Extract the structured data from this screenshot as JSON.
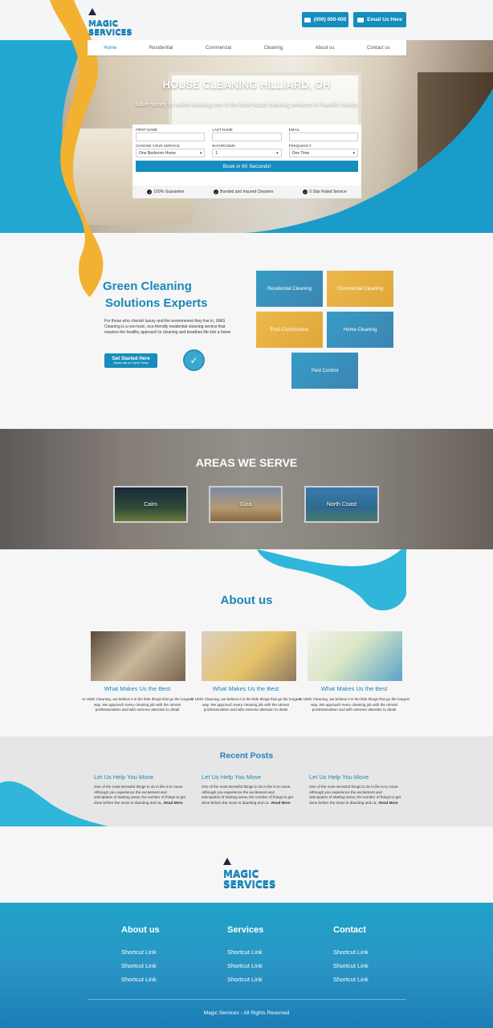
{
  "brand": {
    "line1": "MAGIC",
    "line2": "SERVICES"
  },
  "header": {
    "phone": "(000) 000-000",
    "email_label": "Email Us Here"
  },
  "nav": [
    "Home",
    "Residential",
    "Commercial",
    "Cleaning",
    "About us",
    "Contact us"
  ],
  "hero": {
    "title": "HOUSE CLEANING HILLIARD, OH",
    "subtitle": "Save money by online booking one of the best house cleaning services in Franklin county"
  },
  "form": {
    "first_name_label": "FIRST NAME",
    "last_name_label": "LAST NAME",
    "email_label": "EMAIL",
    "service_label": "CHOOSE YOUR SERVICE",
    "service_value": "One Bedroom Home",
    "bathrooms_label": "BATHROOMS",
    "bathrooms_value": "1",
    "frequency_label": "FREQUENCY",
    "frequency_value": "One Time",
    "book_label": "Book in 60 Seconds!"
  },
  "guarantees": [
    "100% Guarantee",
    "Bonded and Insured Cleaners",
    "5 Star Rated Service"
  ],
  "green": {
    "title_line1": "Green Cleaning",
    "title_line2": "Solutions Experts",
    "text": "For those who cherish luxury and the environment they live in, UMG Cleaning is a non-toxic, eco-friendly residential cleaning service that masters the healthy approach to cleaning and breathes life into a home",
    "cta_main": "Get Started Here",
    "cta_sub": "Speak with an Expert Today"
  },
  "services": [
    "Residential Cleaning",
    "Commercial Cleaning",
    "Post-Construction",
    "Home Cleaning",
    "Pest Control"
  ],
  "areas": {
    "title": "AREAS WE SERVE",
    "items": [
      "Cairo",
      "Giza",
      "North Coast"
    ]
  },
  "about": {
    "title": "About us",
    "cards": [
      {
        "heading": "What Makes Us the Best",
        "text": "At UMG Cleaning, we believe it is the little things that go the longest way. We approach every cleaning job with the utmost professionalism and with extreme attention to detail"
      },
      {
        "heading": "What Makes Us the Best",
        "text": "At UMG Cleaning, we believe it is the little things that go the longest way. We approach every cleaning job with the utmost professionalism and with extreme attention to detail"
      },
      {
        "heading": "What Makes Us the Best",
        "text": "At UMG Cleaning, we believe it is the little things that go the longest way. We approach every cleaning job with the utmost professionalism and with extreme attention to detail"
      }
    ]
  },
  "posts": {
    "title": "Recent Posts",
    "items": [
      {
        "heading": "Let Us Help You Move",
        "text": "One of the most stressful things to do in life is to move. Although you experience the excitement and anticipation of starting anew, the number of things to get done before the move is daunting and ca...",
        "more": "Read More"
      },
      {
        "heading": "Let Us Help You Move",
        "text": "One of the most stressful things to do in life is to move. Although you experience the excitement and anticipation of starting anew, the number of things to get done before the move is daunting and ca...",
        "more": "Read More"
      },
      {
        "heading": "Let Us Help You Move",
        "text": "One of the most stressful things to do in life is to move. Although you experience the excitement and anticipation of starting anew, the number of things to get done before the move is daunting and ca...",
        "more": "Read More"
      }
    ]
  },
  "footer": {
    "columns": [
      {
        "heading": "About us",
        "links": [
          "Shortcut Link",
          "Shortcut Link",
          "Shortcut Link"
        ]
      },
      {
        "heading": "Services",
        "links": [
          "Shortcut Link",
          "Shortcut Link",
          "Shortcut Link"
        ]
      },
      {
        "heading": "Contact",
        "links": [
          "Shortcut Link",
          "Shortcut Link",
          "Shortcut Link"
        ]
      }
    ],
    "copyright": "Magic Services - All Rights Reserved"
  },
  "colors": {
    "primary": "#158dbd",
    "accent": "#f2b130",
    "heading": "#1d86b8"
  }
}
